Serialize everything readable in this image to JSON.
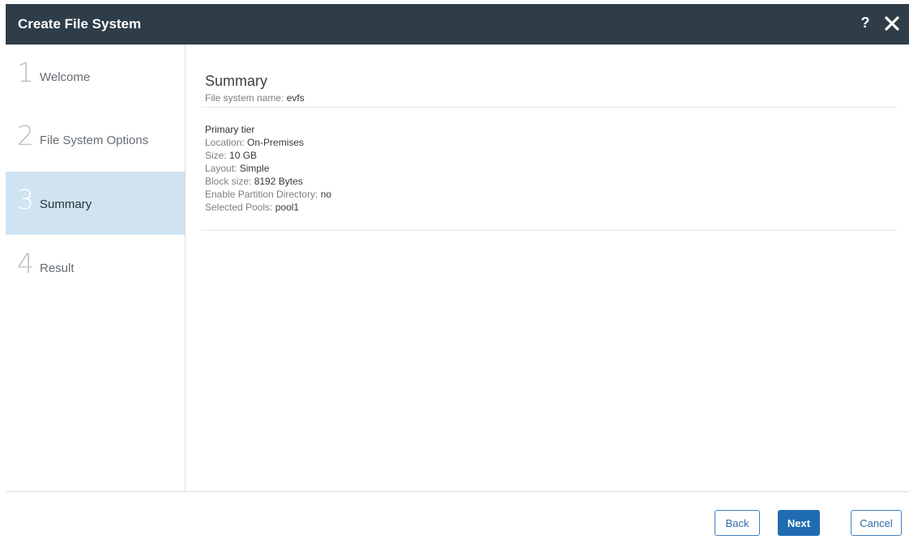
{
  "dialog": {
    "title": "Create File System",
    "help_label": "?"
  },
  "steps": [
    {
      "number": "1",
      "label": "Welcome"
    },
    {
      "number": "2",
      "label": "File System Options"
    },
    {
      "number": "3",
      "label": "Summary"
    },
    {
      "number": "4",
      "label": "Result"
    }
  ],
  "active_step": "Summary",
  "summary": {
    "title": "Summary",
    "fs_name_label": "File system name:",
    "fs_name_value": "evfs",
    "tier_title": "Primary tier",
    "fields": [
      {
        "label": "Location:",
        "value": "On-Premises"
      },
      {
        "label": "Size:",
        "value": "10 GB"
      },
      {
        "label": "Layout:",
        "value": "Simple"
      },
      {
        "label": "Block size:",
        "value": "8192 Bytes"
      },
      {
        "label": "Enable Partition Directory:",
        "value": "no"
      },
      {
        "label": "Selected Pools:",
        "value": "pool1"
      }
    ]
  },
  "buttons": {
    "back": "Back",
    "next": "Next",
    "cancel": "Cancel"
  },
  "colors": {
    "titlebar": "#2e3d48",
    "active_step": "#cfe3f1",
    "primary_button": "#1f6cb0"
  }
}
